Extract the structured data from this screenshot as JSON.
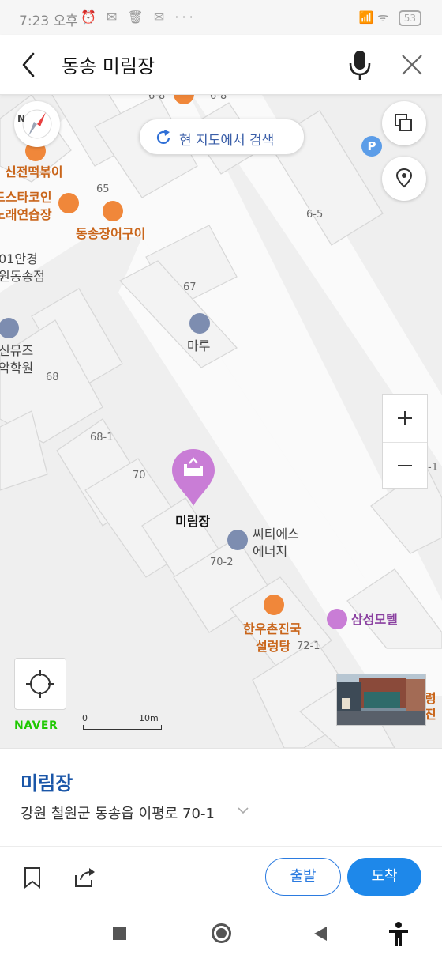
{
  "status_bar": {
    "time": "7:23 오후",
    "left_icons": "⏰ ✉ 🗑 ✉ ···",
    "right_icons": "📶 ᯤ",
    "battery": "53"
  },
  "search": {
    "query": "동송 미림장"
  },
  "map": {
    "current_area_search_label": "현 지도에서 검색",
    "labels": {
      "sinjeon": "신전떡볶이",
      "coin1": "드스타코인",
      "coin2": "노래연습장",
      "jangeo": "동송장어구이",
      "glasses1": "01안경",
      "glasses2": "원동송점",
      "music1": "신뮤즈",
      "music2": "악학원",
      "maru": "마루",
      "mirimjang": "미림장",
      "city1": "씨티에스",
      "city2": "에너지",
      "hanwoo1": "한우촌진국",
      "hanwoo2": "설렁탕",
      "samsung": "삼성모텔",
      "edge_right": "령진",
      "top_cut": "6-8",
      "top_cut2": "6-8"
    },
    "lots": {
      "l65": "65",
      "l6_5": "6-5",
      "l67": "67",
      "l68": "68",
      "l68_1": "68-1",
      "l70": "70",
      "l70_2": "70-2",
      "l72_1": "72-1",
      "l_edge": "-1"
    },
    "naver_logo": "NAVER",
    "scale_start": "0",
    "scale_end": "10m"
  },
  "place": {
    "name": "미림장",
    "address": "강원 철원군 동송읍 이평로 70-1"
  },
  "actions": {
    "depart_label": "출발",
    "arrive_label": "도착"
  },
  "colors": {
    "accent": "#1e88ea",
    "title_blue": "#1a56a8",
    "poi_orange": "#f0873a",
    "pin_purple": "#c97dd6",
    "naver_green": "#1ec800"
  }
}
